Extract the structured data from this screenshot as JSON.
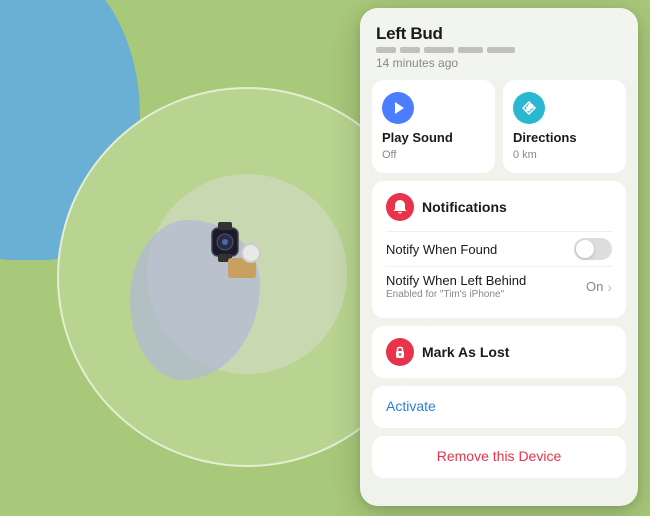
{
  "map": {
    "bg_color": "#a8c87a"
  },
  "panel": {
    "device_name": "Left Bud",
    "device_time": "14 minutes ago",
    "play_sound": {
      "label": "Play Sound",
      "status": "Off",
      "icon": "play-icon"
    },
    "directions": {
      "label": "Directions",
      "status": "0 km",
      "icon": "directions-icon"
    },
    "notifications": {
      "section_title": "Notifications",
      "notify_found": {
        "label": "Notify When Found",
        "toggle_on": false
      },
      "notify_left": {
        "label": "Notify When Left Behind",
        "sublabel": "Enabled for \"Tim's iPhone\"",
        "status": "On"
      }
    },
    "mark_as_lost": {
      "section_title": "Mark As Lost"
    },
    "activate": {
      "label": "Activate"
    },
    "remove": {
      "label": "Remove this Device"
    }
  }
}
